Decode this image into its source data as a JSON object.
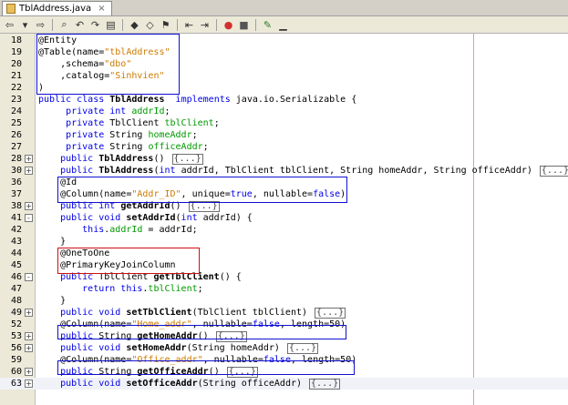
{
  "tab": {
    "title": "TblAddress.java",
    "close": "×"
  },
  "toolbar": {
    "icons": [
      "back-icon",
      "back-dropdown-icon",
      "forward-icon",
      "find-icon",
      "find-previous-icon",
      "find-next-icon",
      "toggle-highlight-icon",
      "previous-bookmark-icon",
      "next-bookmark-icon",
      "toggle-bookmark-icon",
      "shift-left-icon",
      "shift-right-icon",
      "start-macro-icon",
      "stop-macro-icon",
      "comment-icon",
      "uncomment-icon"
    ]
  },
  "lines": [
    {
      "n": "18",
      "fold": "",
      "segs": [
        {
          "t": "@Entity",
          "c": ""
        }
      ]
    },
    {
      "n": "19",
      "fold": "",
      "segs": [
        {
          "t": "@Table(name=",
          "c": ""
        },
        {
          "t": "\"tblAddress\"",
          "c": "str"
        }
      ]
    },
    {
      "n": "20",
      "fold": "",
      "segs": [
        {
          "t": "    ,schema=",
          "c": ""
        },
        {
          "t": "\"dbo\"",
          "c": "str"
        }
      ]
    },
    {
      "n": "21",
      "fold": "",
      "segs": [
        {
          "t": "    ,catalog=",
          "c": ""
        },
        {
          "t": "\"Sinhvien\"",
          "c": "str"
        }
      ]
    },
    {
      "n": "22",
      "fold": "",
      "segs": [
        {
          "t": ")",
          "c": ""
        }
      ]
    },
    {
      "n": "23",
      "fold": "",
      "segs": [
        {
          "t": "public class ",
          "c": "kw"
        },
        {
          "t": "TblAddress",
          "c": "bold"
        },
        {
          "t": "  ",
          "c": ""
        },
        {
          "t": "implements",
          "c": "kw"
        },
        {
          "t": " java.io.Serializable {",
          "c": ""
        }
      ]
    },
    {
      "n": "24",
      "fold": "",
      "segs": [
        {
          "t": "     private int ",
          "c": "kw"
        },
        {
          "t": "addrId",
          "c": "fld"
        },
        {
          "t": ";",
          "c": ""
        }
      ]
    },
    {
      "n": "25",
      "fold": "",
      "segs": [
        {
          "t": "     private ",
          "c": "kw"
        },
        {
          "t": "TblClient ",
          "c": ""
        },
        {
          "t": "tblClient",
          "c": "fld"
        },
        {
          "t": ";",
          "c": ""
        }
      ]
    },
    {
      "n": "26",
      "fold": "",
      "segs": [
        {
          "t": "     private ",
          "c": "kw"
        },
        {
          "t": "String ",
          "c": ""
        },
        {
          "t": "homeAddr",
          "c": "fld"
        },
        {
          "t": ";",
          "c": ""
        }
      ]
    },
    {
      "n": "27",
      "fold": "",
      "segs": [
        {
          "t": "     private ",
          "c": "kw"
        },
        {
          "t": "String ",
          "c": ""
        },
        {
          "t": "officeAddr",
          "c": "fld"
        },
        {
          "t": ";",
          "c": ""
        }
      ]
    },
    {
      "n": "28",
      "fold": "+",
      "segs": [
        {
          "t": "    public ",
          "c": "kw"
        },
        {
          "t": "TblAddress",
          "c": "bold"
        },
        {
          "t": "() ",
          "c": ""
        }
      ],
      "collapsed": "{...}"
    },
    {
      "n": "30",
      "fold": "+",
      "segs": [
        {
          "t": "    public ",
          "c": "kw"
        },
        {
          "t": "TblAddress",
          "c": "bold"
        },
        {
          "t": "(",
          "c": ""
        },
        {
          "t": "int",
          "c": "kw"
        },
        {
          "t": " addrId, TblClient tblClient, String homeAddr, String officeAddr) ",
          "c": ""
        }
      ],
      "collapsed": "{...}"
    },
    {
      "n": "36",
      "fold": "",
      "segs": [
        {
          "t": "    @Id",
          "c": ""
        }
      ]
    },
    {
      "n": "37",
      "fold": "",
      "segs": [
        {
          "t": "    @Column(name=",
          "c": ""
        },
        {
          "t": "\"Addr_ID\"",
          "c": "str"
        },
        {
          "t": ", unique=",
          "c": ""
        },
        {
          "t": "true",
          "c": "kw"
        },
        {
          "t": ", nullable=",
          "c": ""
        },
        {
          "t": "false",
          "c": "kw"
        },
        {
          "t": ")",
          "c": ""
        }
      ]
    },
    {
      "n": "38",
      "fold": "+",
      "segs": [
        {
          "t": "    public int ",
          "c": "kw"
        },
        {
          "t": "getAddrId",
          "c": "bold"
        },
        {
          "t": "() ",
          "c": ""
        }
      ],
      "collapsed": "{...}"
    },
    {
      "n": "41",
      "fold": "-",
      "segs": [
        {
          "t": "    public void ",
          "c": "kw"
        },
        {
          "t": "setAddrId",
          "c": "bold"
        },
        {
          "t": "(",
          "c": ""
        },
        {
          "t": "int",
          "c": "kw"
        },
        {
          "t": " addrId) {",
          "c": ""
        }
      ]
    },
    {
      "n": "42",
      "fold": "",
      "segs": [
        {
          "t": "        this",
          "c": "kw"
        },
        {
          "t": ".",
          "c": ""
        },
        {
          "t": "addrId",
          "c": "fld"
        },
        {
          "t": " = addrId;",
          "c": ""
        }
      ]
    },
    {
      "n": "43",
      "fold": "",
      "segs": [
        {
          "t": "    }",
          "c": ""
        }
      ]
    },
    {
      "n": "44",
      "fold": "",
      "segs": [
        {
          "t": "    @OneToOne",
          "c": ""
        }
      ]
    },
    {
      "n": "45",
      "fold": "",
      "segs": [
        {
          "t": "    @PrimaryKeyJoinColumn",
          "c": ""
        }
      ]
    },
    {
      "n": "46",
      "fold": "-",
      "segs": [
        {
          "t": "    public ",
          "c": "kw"
        },
        {
          "t": "TblClient ",
          "c": ""
        },
        {
          "t": "getTblClient",
          "c": "bold"
        },
        {
          "t": "() {",
          "c": ""
        }
      ]
    },
    {
      "n": "47",
      "fold": "",
      "segs": [
        {
          "t": "        return this",
          "c": "kw"
        },
        {
          "t": ".",
          "c": ""
        },
        {
          "t": "tblClient",
          "c": "fld"
        },
        {
          "t": ";",
          "c": ""
        }
      ]
    },
    {
      "n": "48",
      "fold": "",
      "segs": [
        {
          "t": "    }",
          "c": ""
        }
      ]
    },
    {
      "n": "49",
      "fold": "+",
      "segs": [
        {
          "t": "    public void ",
          "c": "kw"
        },
        {
          "t": "setTblClient",
          "c": "bold"
        },
        {
          "t": "(TblClient tblClient) ",
          "c": ""
        }
      ],
      "collapsed": "{...}"
    },
    {
      "n": "52",
      "fold": "",
      "segs": [
        {
          "t": "    @Column(name=",
          "c": ""
        },
        {
          "t": "\"Home_addr\"",
          "c": "str"
        },
        {
          "t": ", nullable=",
          "c": ""
        },
        {
          "t": "false",
          "c": "kw"
        },
        {
          "t": ", length=50)",
          "c": ""
        }
      ]
    },
    {
      "n": "53",
      "fold": "+",
      "segs": [
        {
          "t": "    public ",
          "c": "kw"
        },
        {
          "t": "String ",
          "c": ""
        },
        {
          "t": "getHomeAddr",
          "c": "bold"
        },
        {
          "t": "() ",
          "c": ""
        }
      ],
      "collapsed": "{...}"
    },
    {
      "n": "56",
      "fold": "+",
      "segs": [
        {
          "t": "    public void ",
          "c": "kw"
        },
        {
          "t": "setHomeAddr",
          "c": "bold"
        },
        {
          "t": "(String homeAddr) ",
          "c": ""
        }
      ],
      "collapsed": "{...}"
    },
    {
      "n": "59",
      "fold": "",
      "segs": [
        {
          "t": "    @Column(name=",
          "c": ""
        },
        {
          "t": "\"Office_addr\"",
          "c": "str"
        },
        {
          "t": ", nullable=",
          "c": ""
        },
        {
          "t": "false",
          "c": "kw"
        },
        {
          "t": ", length=50)",
          "c": ""
        }
      ]
    },
    {
      "n": "60",
      "fold": "+",
      "segs": [
        {
          "t": "    public ",
          "c": "kw"
        },
        {
          "t": "String ",
          "c": ""
        },
        {
          "t": "getOfficeAddr",
          "c": "bold"
        },
        {
          "t": "() ",
          "c": ""
        }
      ],
      "collapsed": "{...}"
    },
    {
      "n": "63",
      "fold": "+",
      "segs": [
        {
          "t": "    public void ",
          "c": "kw"
        },
        {
          "t": "setOfficeAddr",
          "c": "bold"
        },
        {
          "t": "(String officeAddr) ",
          "c": ""
        }
      ],
      "collapsed": "{...}"
    }
  ]
}
